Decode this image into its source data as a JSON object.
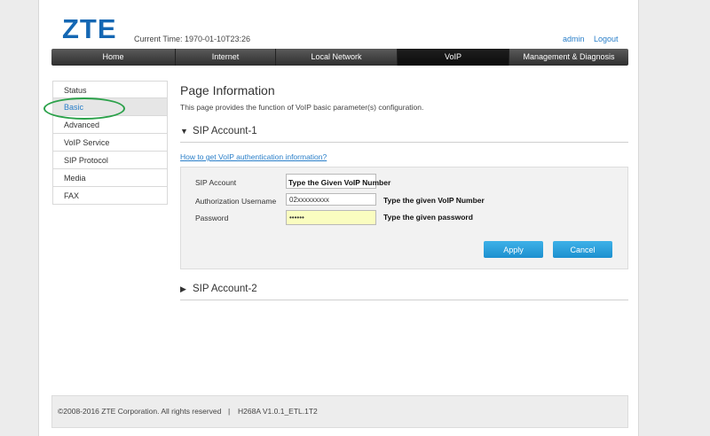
{
  "header": {
    "logo": "ZTE",
    "current_time_label": "Current Time:",
    "current_time_value": "1970-01-10T23:26",
    "user": "admin",
    "logout": "Logout"
  },
  "nav": {
    "tabs": [
      {
        "label": "Home"
      },
      {
        "label": "Internet"
      },
      {
        "label": "Local Network"
      },
      {
        "label": "VoIP",
        "active": true
      },
      {
        "label": "Management & Diagnosis"
      }
    ]
  },
  "sidebar": {
    "items": [
      {
        "label": "Status"
      },
      {
        "label": "Basic",
        "active": true
      },
      {
        "label": "Advanced"
      },
      {
        "label": "VoIP Service"
      },
      {
        "label": "SIP Protocol"
      },
      {
        "label": "Media"
      },
      {
        "label": "FAX"
      }
    ]
  },
  "main": {
    "title": "Page Information",
    "description": "This page provides the function of VoIP basic parameter(s) configuration.",
    "section1": {
      "arrow": "▼",
      "title": "SIP Account-1"
    },
    "help_link": "How to get VoIP authentication information?",
    "form": {
      "sip_account_label": "SIP Account",
      "auth_username_label": "Authorization Username",
      "auth_username_value": "02xxxxxxxxx",
      "password_label": "Password",
      "password_value": "••••••"
    },
    "annotations": {
      "sip_account": "Type the Given VoIP Number",
      "auth_username": "Type the given VoIP Number",
      "password": "Type the given password"
    },
    "apply_label": "Apply",
    "cancel_label": "Cancel",
    "section2": {
      "arrow": "▶",
      "title": "SIP Account-2"
    }
  },
  "footer": {
    "copyright": "©2008-2016 ZTE Corporation. All rights reserved",
    "separator": "|",
    "version": "H268A V1.0.1_ETL.1T2"
  },
  "colors": {
    "accent": "#2a7fc9",
    "logo": "#1467b3",
    "button": "#2a9fdf",
    "highlight_ring": "#2ba14a",
    "password_bg": "#fafdc0"
  }
}
